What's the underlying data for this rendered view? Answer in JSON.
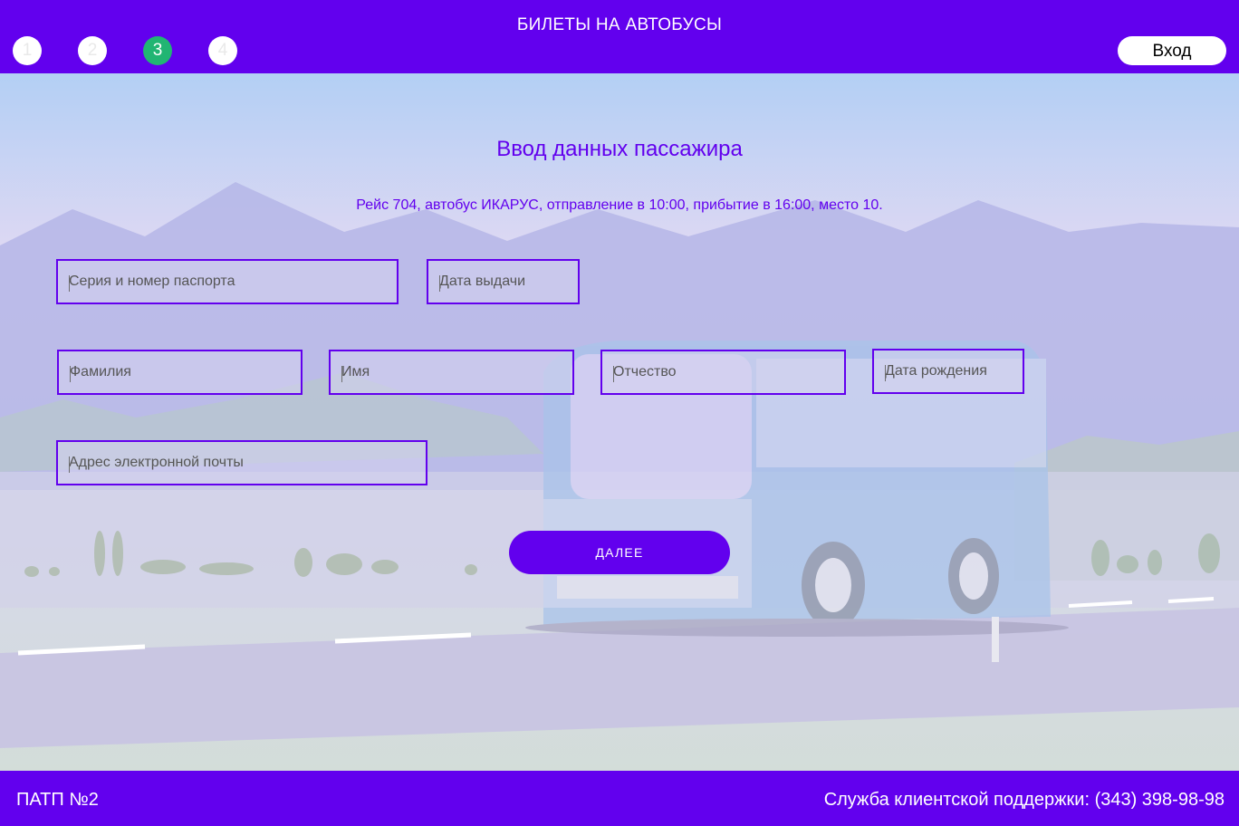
{
  "header": {
    "title": "БИЛЕТЫ НА АВТОБУСЫ",
    "steps": [
      {
        "label": "1",
        "state": "inactive"
      },
      {
        "label": "2",
        "state": "inactive"
      },
      {
        "label": "3",
        "state": "active"
      },
      {
        "label": "4",
        "state": "inactive"
      }
    ],
    "login_label": "Вход"
  },
  "form": {
    "title": "Ввод данных пассажира",
    "trip_info": "Рейс 704, автобус ИКАРУС, отправление в 10:00, прибытие в 16:00, место 10.",
    "fields": {
      "passport": {
        "placeholder": "Серия и номер паспорта",
        "value": ""
      },
      "issue_date": {
        "placeholder": "Дата выдачи",
        "value": ""
      },
      "last_name": {
        "placeholder": "Фамилия",
        "value": ""
      },
      "first_name": {
        "placeholder": "Имя",
        "value": ""
      },
      "patronymic": {
        "placeholder": "Отчество",
        "value": ""
      },
      "birth_date": {
        "placeholder": "Дата рождения",
        "value": ""
      },
      "email": {
        "placeholder": "Адрес электронной почты",
        "value": ""
      }
    },
    "next_label": "ДАЛЕЕ"
  },
  "footer": {
    "org": "ПАТП №2",
    "support": "Служба клиентской поддержки: (343) 398-98-98"
  },
  "colors": {
    "accent": "#6200ee",
    "active_step": "#21b573",
    "surface": "#ffffff"
  }
}
